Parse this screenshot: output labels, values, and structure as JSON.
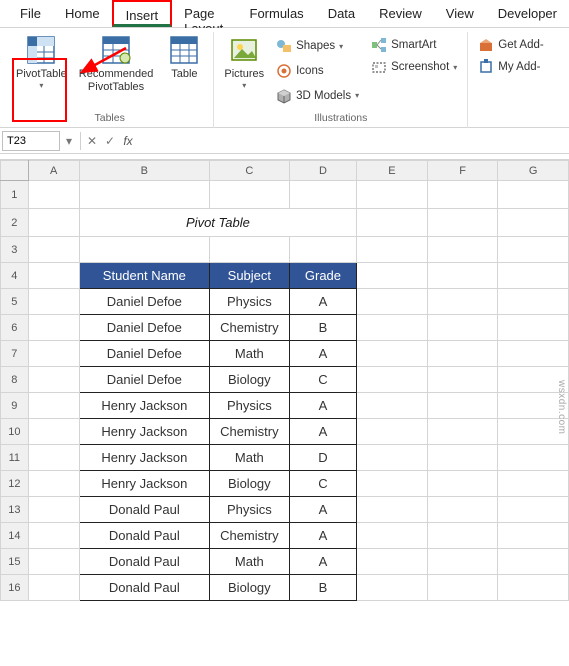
{
  "tabs": [
    "File",
    "Home",
    "Insert",
    "Page Layout",
    "Formulas",
    "Data",
    "Review",
    "View",
    "Developer"
  ],
  "active_tab": "Insert",
  "ribbon": {
    "tables": {
      "pivot_table": "PivotTable",
      "recommended": "Recommended\nPivotTables",
      "table": "Table",
      "label": "Tables"
    },
    "illustrations": {
      "pictures": "Pictures",
      "shapes": "Shapes",
      "icons": "Icons",
      "models": "3D Models",
      "smartart": "SmartArt",
      "screenshot": "Screenshot",
      "label": "Illustrations"
    },
    "addins": {
      "get": "Get Add-",
      "my": "My Add-"
    }
  },
  "name_box": "T23",
  "title": "Pivot Table",
  "headers": {
    "b": "Student Name",
    "c": "Subject",
    "d": "Grade"
  },
  "rows": [
    {
      "b": "Daniel Defoe",
      "c": "Physics",
      "d": "A"
    },
    {
      "b": "Daniel Defoe",
      "c": "Chemistry",
      "d": "B"
    },
    {
      "b": "Daniel Defoe",
      "c": "Math",
      "d": "A"
    },
    {
      "b": "Daniel Defoe",
      "c": "Biology",
      "d": "C"
    },
    {
      "b": "Henry Jackson",
      "c": "Physics",
      "d": "A"
    },
    {
      "b": "Henry Jackson",
      "c": "Chemistry",
      "d": "A"
    },
    {
      "b": "Henry Jackson",
      "c": "Math",
      "d": "D"
    },
    {
      "b": "Henry Jackson",
      "c": "Biology",
      "d": "C"
    },
    {
      "b": "Donald Paul",
      "c": "Physics",
      "d": "A"
    },
    {
      "b": "Donald Paul",
      "c": "Chemistry",
      "d": "A"
    },
    {
      "b": "Donald Paul",
      "c": "Math",
      "d": "A"
    },
    {
      "b": "Donald Paul",
      "c": "Biology",
      "d": "B"
    }
  ],
  "cols": [
    "A",
    "B",
    "C",
    "D",
    "E",
    "F",
    "G"
  ],
  "watermark": "wsxdn.com"
}
